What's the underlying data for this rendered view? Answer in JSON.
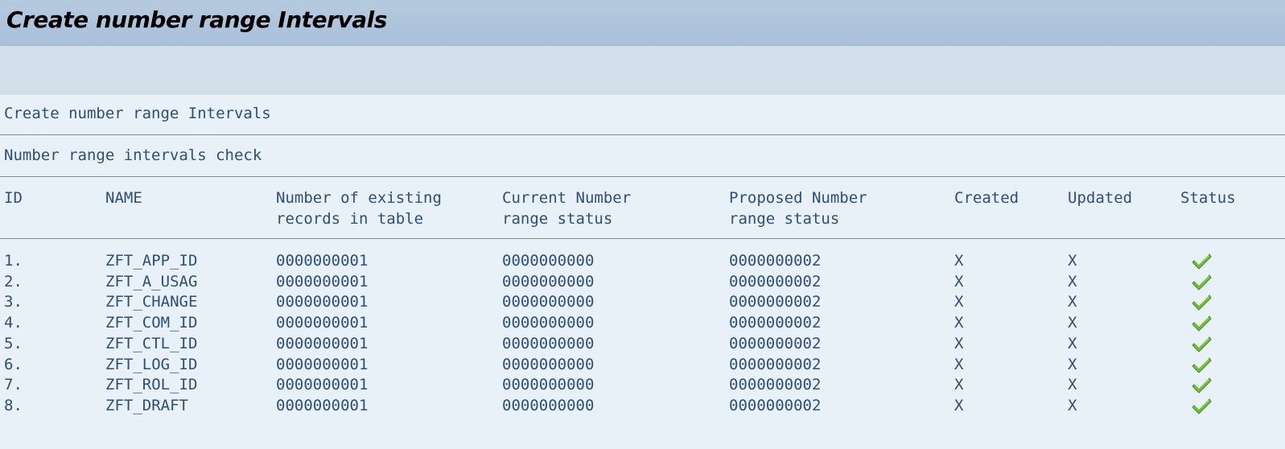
{
  "window": {
    "title": "Create number range Intervals"
  },
  "report": {
    "heading": "Create number range Intervals",
    "subheading": "Number range intervals check"
  },
  "table": {
    "columns": {
      "id": "ID",
      "name": "NAME",
      "existing_l1": "Number of existing",
      "existing_l2": "records in table",
      "current_l1": "Current Number",
      "current_l2": "range status",
      "proposed_l1": "Proposed Number",
      "proposed_l2": "range status",
      "created": "Created",
      "updated": "Updated",
      "status": "Status"
    },
    "rows": [
      {
        "id": "1.",
        "name": "ZFT_APP_ID",
        "existing": "0000000001",
        "current": "0000000000",
        "proposed": "0000000002",
        "created": "X",
        "updated": "X",
        "status_icon": "green-check-icon"
      },
      {
        "id": "2.",
        "name": "ZFT_A_USAG",
        "existing": "0000000001",
        "current": "0000000000",
        "proposed": "0000000002",
        "created": "X",
        "updated": "X",
        "status_icon": "green-check-icon"
      },
      {
        "id": "3.",
        "name": "ZFT_CHANGE",
        "existing": "0000000001",
        "current": "0000000000",
        "proposed": "0000000002",
        "created": "X",
        "updated": "X",
        "status_icon": "green-check-icon"
      },
      {
        "id": "4.",
        "name": "ZFT_COM_ID",
        "existing": "0000000001",
        "current": "0000000000",
        "proposed": "0000000002",
        "created": "X",
        "updated": "X",
        "status_icon": "green-check-icon"
      },
      {
        "id": "5.",
        "name": "ZFT_CTL_ID",
        "existing": "0000000001",
        "current": "0000000000",
        "proposed": "0000000002",
        "created": "X",
        "updated": "X",
        "status_icon": "green-check-icon"
      },
      {
        "id": "6.",
        "name": "ZFT_LOG_ID",
        "existing": "0000000001",
        "current": "0000000000",
        "proposed": "0000000002",
        "created": "X",
        "updated": "X",
        "status_icon": "green-check-icon"
      },
      {
        "id": "7.",
        "name": "ZFT_ROL_ID",
        "existing": "0000000001",
        "current": "0000000000",
        "proposed": "0000000002",
        "created": "X",
        "updated": "X",
        "status_icon": "green-check-icon"
      },
      {
        "id": "8.",
        "name": "ZFT_DRAFT",
        "existing": "0000000001",
        "current": "0000000000",
        "proposed": "0000000002",
        "created": "X",
        "updated": "X",
        "status_icon": "green-check-icon"
      }
    ]
  },
  "colors": {
    "title_bar": "#aec4dc",
    "toolbar": "#d2dfea",
    "content_bg": "#e8f0f8",
    "text": "#2e4f78",
    "check_green": "#5fae2b"
  }
}
